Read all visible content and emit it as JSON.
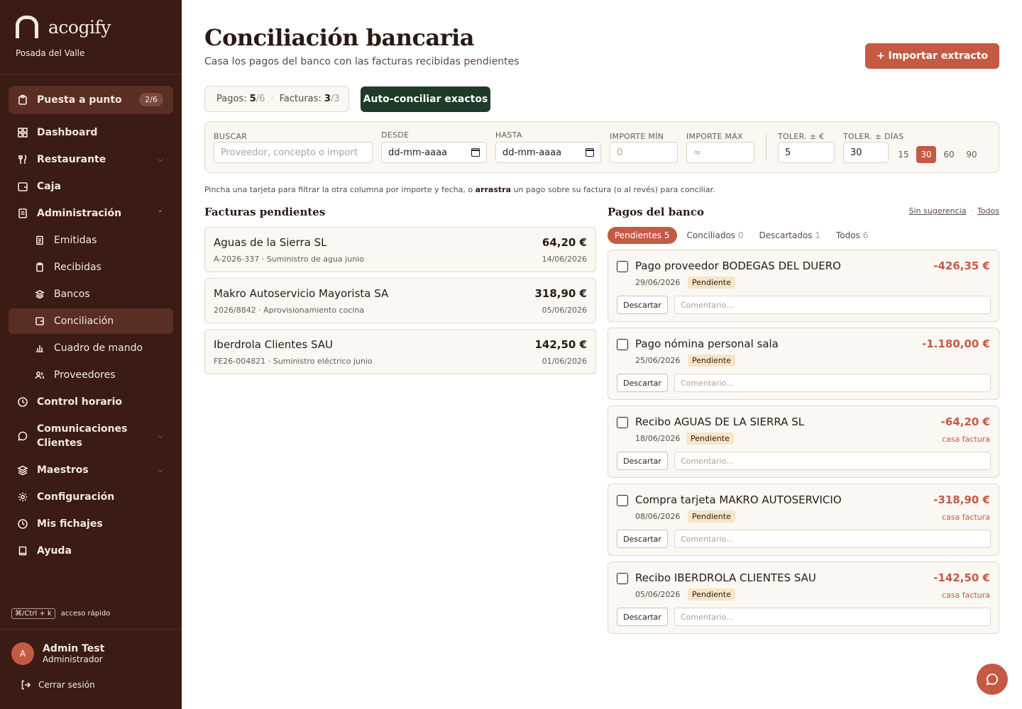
{
  "brand": {
    "name": "acogify",
    "venue": "Posada del Valle"
  },
  "sidebar": {
    "setup": {
      "label": "Puesta a punto",
      "badge": "2/6"
    },
    "items": [
      {
        "label": "Dashboard",
        "icon": "grid-icon"
      },
      {
        "label": "Restaurante",
        "icon": "utensils-icon"
      },
      {
        "label": "Caja",
        "icon": "cash-register-icon"
      },
      {
        "label": "Administración",
        "icon": "document-icon"
      },
      {
        "label": "Emitidas",
        "icon": "file-icon"
      },
      {
        "label": "Recibidas",
        "icon": "clipboard-icon"
      },
      {
        "label": "Bancos",
        "icon": "layers-icon"
      },
      {
        "label": "Conciliación",
        "icon": "wallet-icon"
      },
      {
        "label": "Cuadro de mando",
        "icon": "bar-chart-icon"
      },
      {
        "label": "Proveedores",
        "icon": "users-icon"
      },
      {
        "label": "Control horario",
        "icon": "clock-icon"
      },
      {
        "label": "Comunicaciones Clientes",
        "icon": "chat-icon"
      },
      {
        "label": "Maestros",
        "icon": "layers-icon"
      },
      {
        "label": "Configuración",
        "icon": "gear-icon"
      },
      {
        "label": "Mis fichajes",
        "icon": "clock-icon"
      },
      {
        "label": "Ayuda",
        "icon": "book-icon"
      }
    ],
    "shortcut": {
      "key": "⌘/Ctrl + k",
      "label": "acceso rápido"
    },
    "user": {
      "initial": "A",
      "name": "Admin Test",
      "role": "Administrador"
    },
    "logout": "Cerrar sesión"
  },
  "page": {
    "title": "Conciliación bancaria",
    "subtitle": "Casa los pagos del banco con las facturas recibidas pendientes",
    "import_button": "+ Importar extracto",
    "counts": {
      "pagos_label": "Pagos:",
      "pagos_value": "5",
      "pagos_total": "/6",
      "facturas_label": "Facturas:",
      "facturas_value": "3",
      "facturas_total": "/3"
    },
    "auto_button": "Auto-conciliar exactos"
  },
  "filters": {
    "search": {
      "label": "BUSCAR",
      "placeholder": "Proveedor, concepto o import"
    },
    "from": {
      "label": "DESDE",
      "value": "dd-mm-aaaa"
    },
    "to": {
      "label": "HASTA",
      "value": "dd-mm-aaaa"
    },
    "min": {
      "label": "IMPORTE MÍN",
      "placeholder": "0"
    },
    "max": {
      "label": "IMPORTE MÁX",
      "placeholder": "∞"
    },
    "tol_eur": {
      "label": "TOLER. ± €",
      "value": "5"
    },
    "tol_days": {
      "label": "TOLER. ± DÍAS",
      "value": "30"
    },
    "days_options": [
      "15",
      "30",
      "60",
      "90"
    ],
    "days_selected": "30"
  },
  "hint": {
    "before": "Pincha una tarjeta para filtrar la otra columna por importe y fecha, o ",
    "bold": "arrastra",
    "after": " un pago sobre su factura (o al revés) para conciliar."
  },
  "invoices": {
    "title": "Facturas pendientes",
    "items": [
      {
        "name": "Aguas de la Sierra SL",
        "meta": "A-2026-337 · Suministro de agua junio",
        "amount": "64,20 €",
        "date": "14/06/2026"
      },
      {
        "name": "Makro Autoservicio Mayorista SA",
        "meta": "2026/8842 · Aprovisionamiento cocina",
        "amount": "318,90 €",
        "date": "05/06/2026"
      },
      {
        "name": "Iberdrola Clientes SAU",
        "meta": "FE26-004821 · Suministro eléctrico junio",
        "amount": "142,50 €",
        "date": "01/06/2026"
      }
    ]
  },
  "payments": {
    "title": "Pagos del banco",
    "links": [
      "Sin sugerencia",
      "Todos"
    ],
    "tabs": [
      {
        "label": "Pendientes",
        "count": "5"
      },
      {
        "label": "Conciliados",
        "count": "0"
      },
      {
        "label": "Descartados",
        "count": "1"
      },
      {
        "label": "Todos",
        "count": "6"
      }
    ],
    "discard_label": "Descartar",
    "comment_placeholder": "Comentario...",
    "items": [
      {
        "name": "Pago proveedor BODEGAS DEL DUERO",
        "amount": "-426,35 €",
        "date": "29/06/2026",
        "status": "Pendiente",
        "match": ""
      },
      {
        "name": "Pago nómina personal sala",
        "amount": "-1.180,00 €",
        "date": "25/06/2026",
        "status": "Pendiente",
        "match": ""
      },
      {
        "name": "Recibo AGUAS DE LA SIERRA SL",
        "amount": "-64,20 €",
        "date": "18/06/2026",
        "status": "Pendiente",
        "match": "casa factura"
      },
      {
        "name": "Compra tarjeta MAKRO AUTOSERVICIO",
        "amount": "-318,90 €",
        "date": "08/06/2026",
        "status": "Pendiente",
        "match": "casa factura"
      },
      {
        "name": "Recibo IBERDROLA CLIENTES SAU",
        "amount": "-142,50 €",
        "date": "05/06/2026",
        "status": "Pendiente",
        "match": "casa factura"
      }
    ]
  }
}
